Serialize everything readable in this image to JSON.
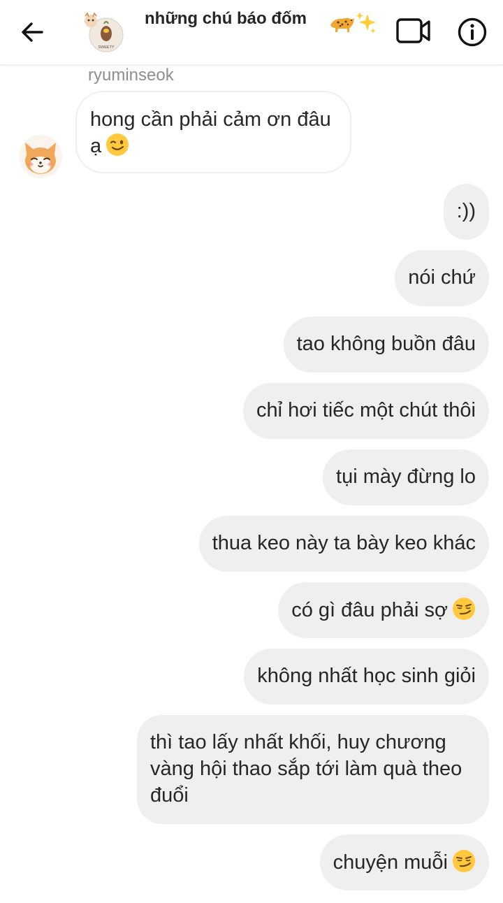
{
  "header": {
    "title": "những chú báo đốm",
    "title_emojis": [
      "leopard-emoji",
      "sparkles-emoji"
    ],
    "back_icon": "arrow-left-icon",
    "video_icon": "video-call-icon",
    "info_icon": "info-icon",
    "avatar_text": "SWEETY"
  },
  "messages": {
    "sender": "ryuminseok",
    "incoming_text": "hong cần phải cảm ơn đâu ạ",
    "incoming_emoji": "winking-face-emoji",
    "outgoing": [
      {
        "text": ":))"
      },
      {
        "text": "nói chứ"
      },
      {
        "text": "tao không buồn đâu"
      },
      {
        "text": "chỉ hơi tiếc một chút thôi"
      },
      {
        "text": "tụi mày đừng lo"
      },
      {
        "text": "thua keo này ta bày keo khác"
      },
      {
        "text": "có gì đâu phải sợ",
        "emoji": "smirking-face-emoji"
      },
      {
        "text": "không nhất học sinh giỏi"
      },
      {
        "text": "thì tao lấy nhất khối, huy chương vàng hội thao sắp tới làm quà theo đuổi"
      },
      {
        "text": "chuyện muỗi",
        "emoji": "smirking-face-emoji"
      }
    ]
  },
  "colors": {
    "outgoing_bubble": "#efefef",
    "text": "#262626",
    "muted": "#8e8e8e",
    "emoji_yellow": "#ffc83d"
  }
}
